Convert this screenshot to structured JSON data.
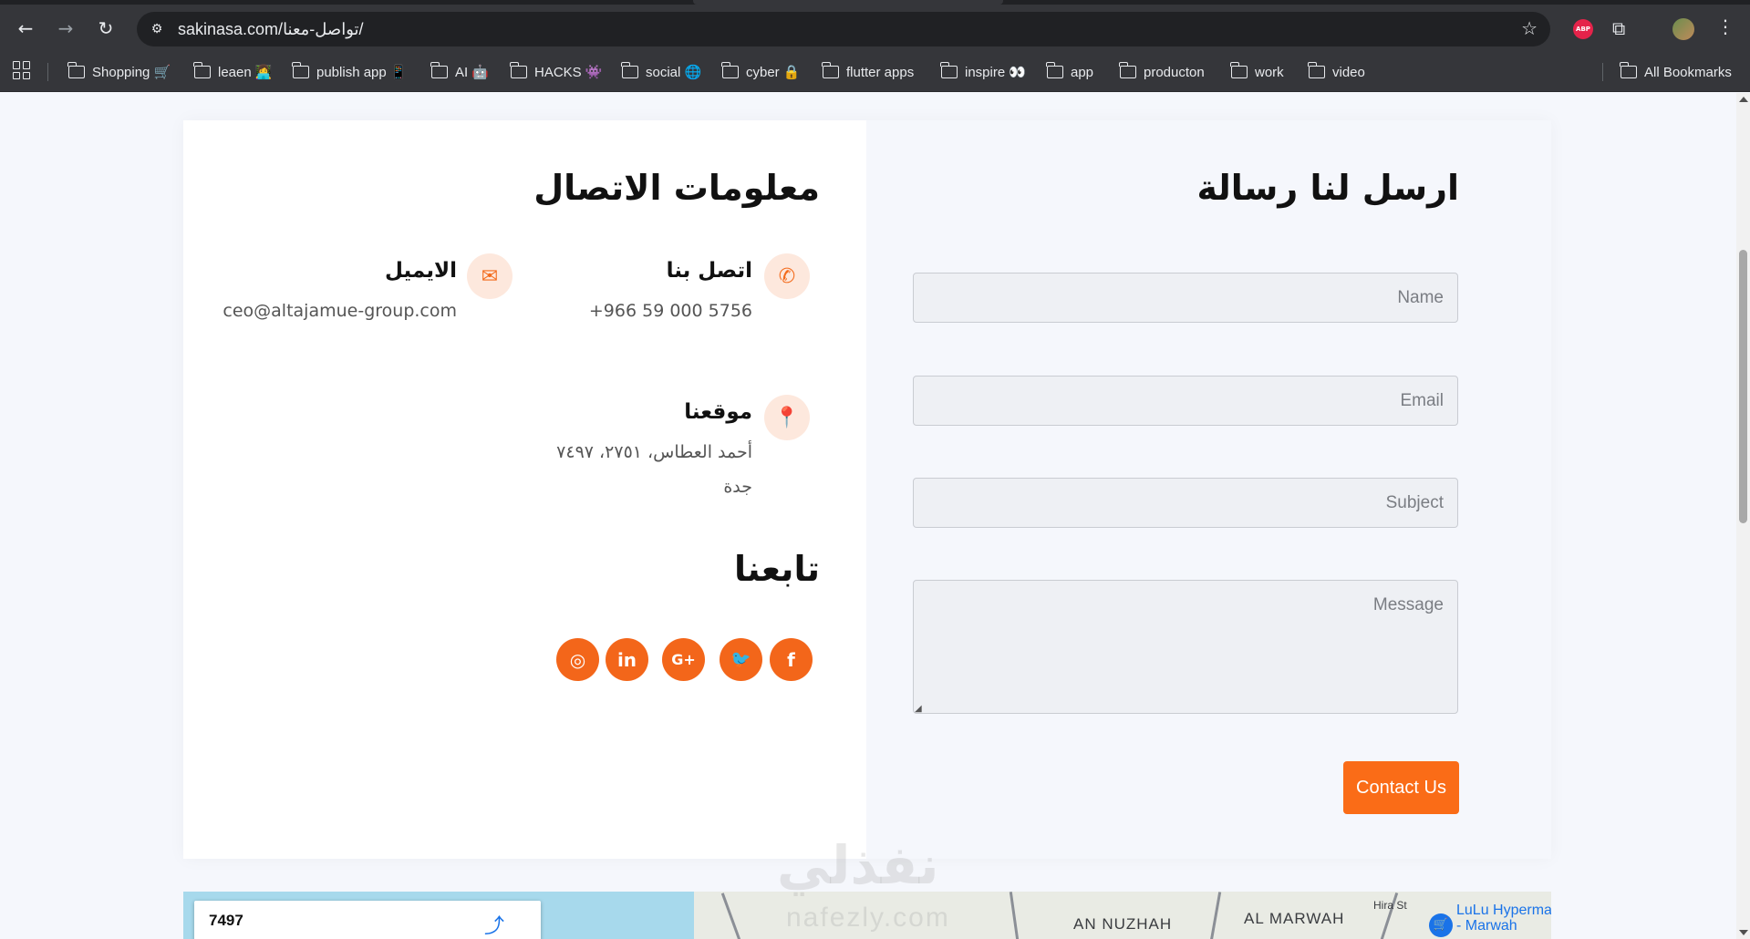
{
  "browser": {
    "url": "sakinasa.com/تواصل-معنا/",
    "back_icon": "back-arrow-icon",
    "extension_abp": "ABP",
    "bookmarks": [
      {
        "label": "Shopping 🛒"
      },
      {
        "label": "leaen 👩‍💻"
      },
      {
        "label": "publish app 📱"
      },
      {
        "label": "AI 🤖"
      },
      {
        "label": "HACKS 👾"
      },
      {
        "label": "social 🌐"
      },
      {
        "label": "cyber 🔒"
      },
      {
        "label": "flutter apps"
      },
      {
        "label": "inspire 👀"
      },
      {
        "label": "app"
      },
      {
        "label": "producton"
      },
      {
        "label": "work"
      },
      {
        "label": "video"
      }
    ],
    "all_bookmarks": "All Bookmarks"
  },
  "form": {
    "title": "ارسل لنا رسالة",
    "name_placeholder": "Name",
    "email_placeholder": "Email",
    "subject_placeholder": "Subject",
    "message_placeholder": "Message",
    "submit_label": "Contact Us"
  },
  "contact_info": {
    "title": "معلومات الاتصال",
    "phone": {
      "heading": "اتصل بنا",
      "value": "+966 59 000 5756",
      "icon": "phone-icon"
    },
    "email": {
      "heading": "الايميل",
      "value": "ceo@altajamue-group.com",
      "icon": "envelope-icon"
    },
    "location": {
      "heading": "موقعنا",
      "line1": "أحمد العطاس، ٢٧٥١، ٧٤٩٧",
      "line2": "جدة",
      "icon": "map-pin-icon"
    },
    "follow_title": "تابعنا",
    "social": [
      {
        "name": "instagram-icon",
        "glyph": "◎"
      },
      {
        "name": "linkedin-icon",
        "glyph": "in"
      },
      {
        "name": "google-plus-icon",
        "glyph": "G+"
      },
      {
        "name": "twitter-icon",
        "glyph": "🐦"
      },
      {
        "name": "facebook-icon",
        "glyph": "f"
      }
    ]
  },
  "map": {
    "search_value": "7497",
    "label_nuzhah": "AN NUZHAH",
    "label_marwah": "AL MARWAH",
    "label_hira": "Hira St",
    "poi_line1": "LuLu Hyperma",
    "poi_line2": "- Marwah"
  },
  "watermark": {
    "arabic": "نفذلي",
    "latin": "nafezly.com"
  },
  "colors": {
    "accent": "#fa6c17",
    "accent_soft": "#fde8dd",
    "panel_bg": "#f5f7fc"
  }
}
